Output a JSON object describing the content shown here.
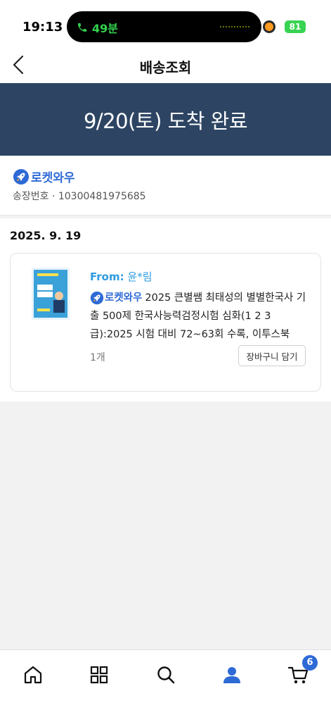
{
  "status_bar": {
    "time": "19:13",
    "call_duration": "49분",
    "battery": "81"
  },
  "header": {
    "title": "배송조회"
  },
  "banner": {
    "status": "9/20(토) 도착 완료"
  },
  "carrier": {
    "name": "로켓와우",
    "tracking_label": "송장번호 · 10300481975685"
  },
  "order": {
    "date": "2025. 9. 19",
    "item": {
      "from_label": "From:",
      "from_name": "윤*림",
      "badge": "로켓와우",
      "description": "2025 큰별쌤 최태성의 별별한국사 기출 500제 한국사능력검정시험 심화(1 2 3급):2025 시험 대비 72~63회 수록, 이투스북",
      "quantity": "1개",
      "cart_button": "장바구니 담기"
    }
  },
  "bottom_nav": {
    "items": [
      "home-icon",
      "category-grid-icon",
      "search-icon",
      "my-account-icon",
      "cart-icon"
    ],
    "active": "my-account-icon",
    "cart_badge": "6"
  },
  "colors": {
    "banner_bg": "#2d4563",
    "brand_blue": "#2e6ad6",
    "from_blue": "#2e9be0",
    "call_green": "#33d24e"
  }
}
